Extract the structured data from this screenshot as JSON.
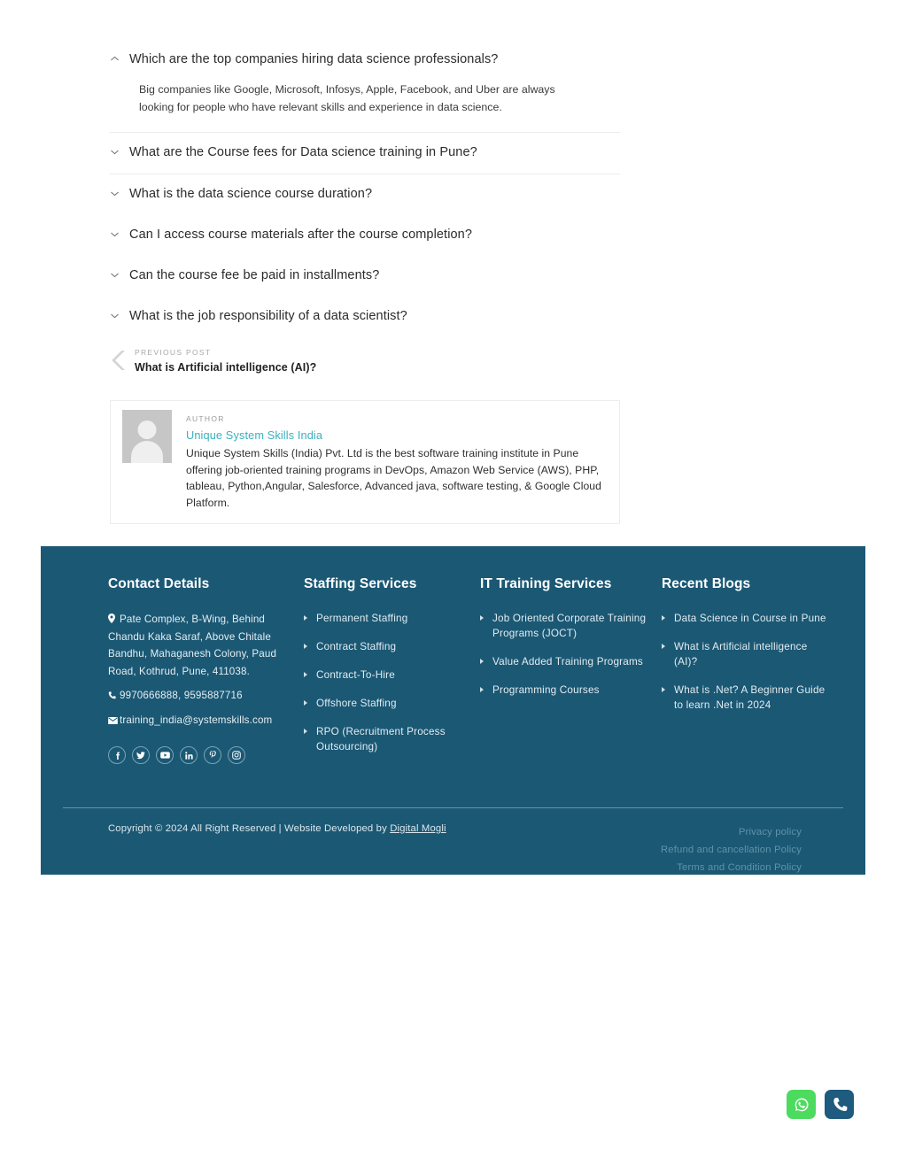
{
  "faq": {
    "items": [
      {
        "question": "Which are the top companies hiring data science professionals?",
        "answer": "Big companies like Google, Microsoft, Infosys, Apple, Facebook, and Uber are always looking for people who have relevant skills and experience in data science.",
        "expanded": true,
        "icon": "chevron-up-icon"
      },
      {
        "question": "What are the Course fees for Data science training in Pune?",
        "expanded": false,
        "icon": "chevron-down-icon"
      },
      {
        "question": "What is the data science course duration?",
        "expanded": false,
        "icon": "chevron-down-icon"
      },
      {
        "question": "Can I access course materials after the course completion?",
        "expanded": false,
        "icon": "chevron-down-icon"
      },
      {
        "question": "Can the course fee be paid in installments?",
        "expanded": false,
        "icon": "chevron-down-icon"
      },
      {
        "question": "What is the job responsibility of a data scientist?",
        "expanded": false,
        "icon": "chevron-down-icon"
      }
    ]
  },
  "previous_post": {
    "label": "PREVIOUS POST",
    "title": "What is Artificial intelligence (AI)?",
    "icon": "chevron-left-icon"
  },
  "author": {
    "label": "AUTHOR",
    "name": "Unique System Skills India",
    "description": "Unique System Skills (India) Pvt. Ltd is the best software training institute in Pune offering job-oriented training programs in DevOps, Amazon Web Service (AWS), PHP, tableau, Python,Angular, Salesforce, Advanced java, software testing, & Google Cloud Platform.",
    "avatar": "user-avatar-placeholder",
    "link_color": "#3cb0bf"
  },
  "footer": {
    "background": "#1b5874",
    "contact": {
      "heading": "Contact Details",
      "address": "Pate Complex, B-Wing, Behind Chandu Kaka Saraf, Above Chitale Bandhu, Mahaganesh Colony, Paud Road, Kothrud, Pune, 411038.",
      "phone": "9970666888, 9595887716",
      "email": "training_india@systemskills.com",
      "socials": [
        {
          "name": "facebook-icon",
          "label": "f"
        },
        {
          "name": "twitter-icon",
          "label": "t"
        },
        {
          "name": "youtube-icon",
          "label": "yt"
        },
        {
          "name": "linkedin-icon",
          "label": "in"
        },
        {
          "name": "pinterest-icon",
          "label": "p"
        },
        {
          "name": "instagram-icon",
          "label": "ig"
        }
      ]
    },
    "staffing": {
      "heading": "Staffing Services",
      "items": [
        "Permanent Staffing",
        "Contract Staffing",
        "Contract-To-Hire",
        "Offshore Staffing",
        "RPO (Recruitment Process Outsourcing)"
      ]
    },
    "training": {
      "heading": "IT Training Services",
      "items": [
        "Job Oriented Corporate Training Programs (JOCT)",
        "Value Added Training Programs",
        "Programming Courses"
      ]
    },
    "blogs": {
      "heading": "Recent Blogs",
      "items": [
        "Data Science in Course in Pune",
        "What is Artificial intelligence (AI)?",
        "What is .Net? A Beginner Guide to learn .Net in 2024"
      ]
    },
    "bottom": {
      "copyright_prefix": "Copyright © 2024 All Right Reserved | Website Developed by ",
      "developer": "Digital Mogli",
      "policies": [
        "Privacy policy",
        "Refund and cancellation Policy",
        "Terms and Condition Policy"
      ]
    }
  },
  "floating_buttons": [
    {
      "name": "whatsapp-button",
      "icon": "whatsapp-icon",
      "color": "#4ddb5f"
    },
    {
      "name": "call-button",
      "icon": "phone-icon",
      "color": "#1e5b7e"
    }
  ]
}
